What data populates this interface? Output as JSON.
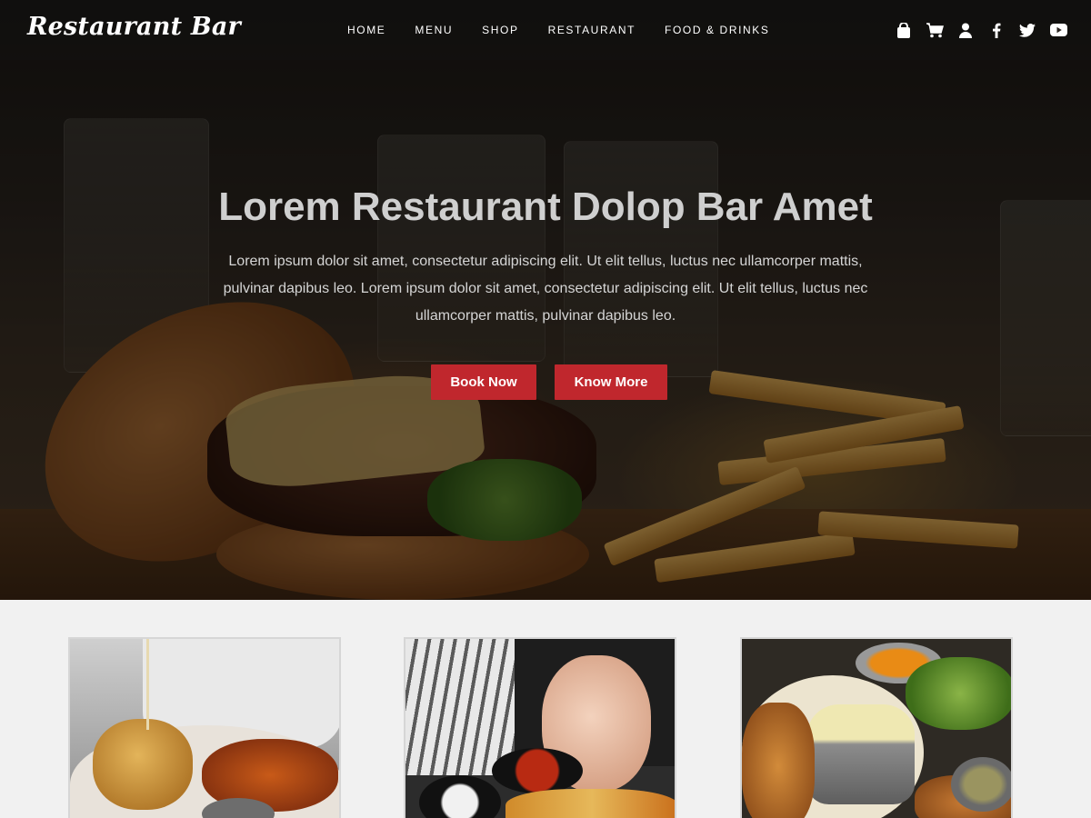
{
  "header": {
    "logo": "Restaurant Bar",
    "nav": [
      "HOME",
      "MENU",
      "SHOP",
      "RESTAURANT",
      "FOOD & DRINKS"
    ],
    "icons": [
      "bag-icon",
      "cart-icon",
      "user-icon",
      "facebook-icon",
      "twitter-icon",
      "youtube-icon"
    ]
  },
  "hero": {
    "title": "Lorem Restaurant Dolop Bar Amet",
    "text": "Lorem ipsum dolor sit amet, consectetur adipiscing elit. Ut elit tellus, luctus nec ullamcorper mattis, pulvinar dapibus leo. Lorem ipsum dolor sit amet, consectetur adipiscing elit. Ut elit tellus, luctus nec ullamcorper mattis, pulvinar dapibus leo.",
    "buttons": {
      "book": "Book Now",
      "know": "Know More"
    }
  },
  "colors": {
    "accent": "#c0272d",
    "section_bg": "#f1f1f1"
  }
}
